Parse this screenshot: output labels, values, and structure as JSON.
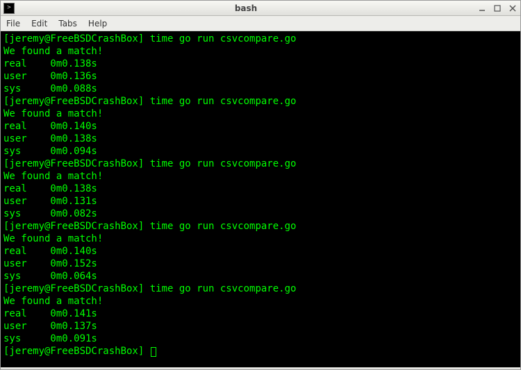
{
  "window": {
    "title": "bash"
  },
  "menubar": {
    "items": [
      "File",
      "Edit",
      "Tabs",
      "Help"
    ]
  },
  "prompt": "[jeremy@FreeBSDCrashBox]",
  "command": "time go run csvcompare.go",
  "match_message": "We found a match!",
  "runs": [
    {
      "real": "0m0.138s",
      "user": "0m0.136s",
      "sys": "0m0.088s"
    },
    {
      "real": "0m0.140s",
      "user": "0m0.138s",
      "sys": "0m0.094s"
    },
    {
      "real": "0m0.138s",
      "user": "0m0.131s",
      "sys": "0m0.082s"
    },
    {
      "real": "0m0.140s",
      "user": "0m0.152s",
      "sys": "0m0.064s"
    },
    {
      "real": "0m0.141s",
      "user": "0m0.137s",
      "sys": "0m0.091s"
    }
  ],
  "labels": {
    "real": "real",
    "user": "user",
    "sys": "sys"
  }
}
